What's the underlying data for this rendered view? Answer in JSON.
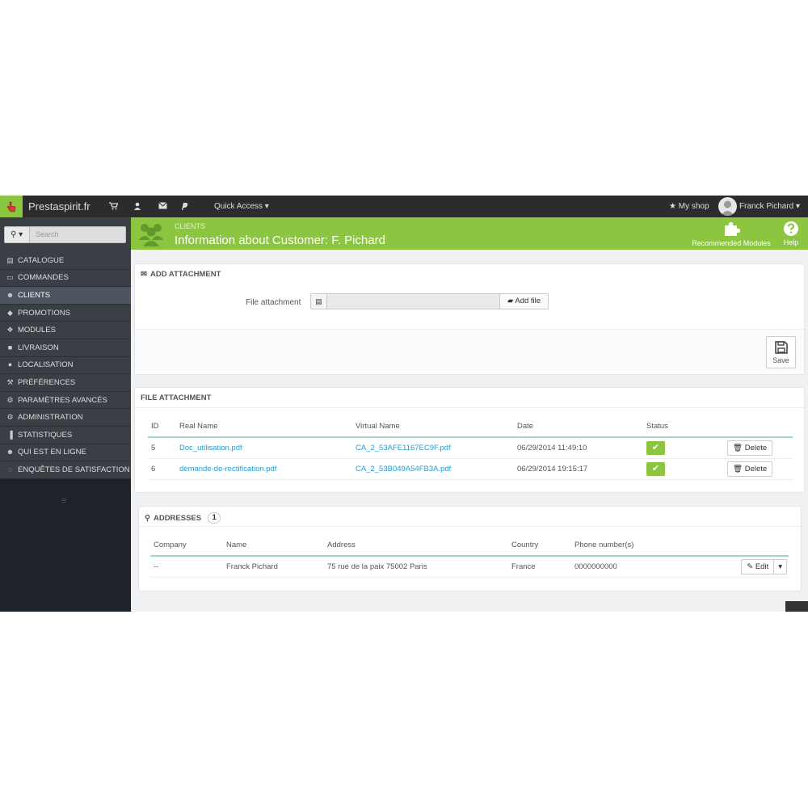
{
  "topbar": {
    "brand": "Prestaspirit.fr",
    "quick_access": "Quick Access ▾",
    "my_shop": "My shop",
    "user": "Franck Pichard ▾"
  },
  "header": {
    "breadcrumb": "CLIENTS",
    "title": "Information about Customer: F. Pichard",
    "recommended": "Recommended Modules",
    "help": "Help"
  },
  "sidebar": {
    "search_placeholder": "Search",
    "items": [
      {
        "label": "CATALOGUE",
        "icon": "▤"
      },
      {
        "label": "COMMANDES",
        "icon": "▭"
      },
      {
        "label": "CLIENTS",
        "icon": "☻"
      },
      {
        "label": "PROMOTIONS",
        "icon": "◆"
      },
      {
        "label": "MODULES",
        "icon": "❖"
      },
      {
        "label": "LIVRAISON",
        "icon": "■"
      },
      {
        "label": "LOCALISATION",
        "icon": "●"
      },
      {
        "label": "PRÉFÉRENCES",
        "icon": "⚒"
      },
      {
        "label": "PARAMÈTRES AVANCÉS",
        "icon": "⚙"
      },
      {
        "label": "ADMINISTRATION",
        "icon": "⚙"
      },
      {
        "label": "STATISTIQUES",
        "icon": "▐"
      },
      {
        "label": "QUI EST EN LIGNE",
        "icon": "☻"
      },
      {
        "label": "ENQUÊTES DE SATISFACTION",
        "icon": "◌"
      }
    ]
  },
  "add_attachment": {
    "title": "ADD ATTACHMENT",
    "file_label": "File attachment",
    "add_file": "Add file",
    "save": "Save"
  },
  "file_attachment": {
    "title": "FILE ATTACHMENT",
    "columns": [
      "ID",
      "Real Name",
      "Virtual Name",
      "Date",
      "Status"
    ],
    "rows": [
      {
        "id": "5",
        "real_name": "Doc_utilisation.pdf",
        "virtual_name": "CA_2_53AFE1167EC9F.pdf",
        "date": "06/29/2014 11:49:10",
        "delete": "Delete"
      },
      {
        "id": "6",
        "real_name": "demande-de-rectification.pdf",
        "virtual_name": "CA_2_53B049A54FB3A.pdf",
        "date": "06/29/2014 19:15:17",
        "delete": "Delete"
      }
    ]
  },
  "addresses": {
    "title": "ADDRESSES",
    "count": "1",
    "columns": [
      "Company",
      "Name",
      "Address",
      "Country",
      "Phone number(s)"
    ],
    "rows": [
      {
        "company": "--",
        "name": "Franck Pichard",
        "address": "75 rue de la paix 75002 Paris",
        "country": "France",
        "phone": "0000000000",
        "edit": "Edit"
      }
    ]
  },
  "colors": {
    "brand_green": "#8cc540",
    "sidebar_bg": "#3a3f45",
    "link_blue": "#1f9fd6"
  }
}
